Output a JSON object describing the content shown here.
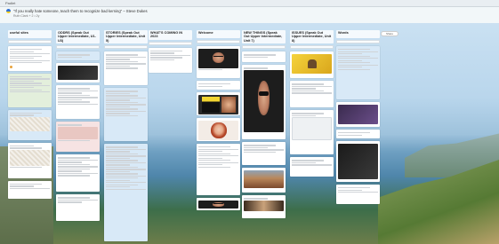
{
  "topbar": {
    "brand": "Padlet"
  },
  "board": {
    "title": "\"If you really hate someone, teach them to recognize bad kerning\" – Steve Dukes",
    "subtitle": "Ruth Clark + 2 • 2y"
  },
  "header": {
    "share_label": "Share"
  },
  "columns": [
    {
      "title": "useful sites"
    },
    {
      "title": "ODDRS (Speak Out Upper Intermediate, U1-U3)"
    },
    {
      "title": "STORIES (Speak Out Upper Intermediate, Unit 5)"
    },
    {
      "title": "WHAT'S COMING IN 2023"
    },
    {
      "title": "Welcome"
    },
    {
      "title": "NEW THINGS (Speak Out Upper Intermediate, Unit 7)"
    },
    {
      "title": "ISSUES (Speak Out Upper Intermediate, Unit 8)"
    },
    {
      "title": "Words"
    }
  ],
  "colors": {
    "accent_orange": "#e8a23c",
    "ukraine_blue": "#2f6fd3",
    "ukraine_yellow": "#f4cf1a"
  }
}
